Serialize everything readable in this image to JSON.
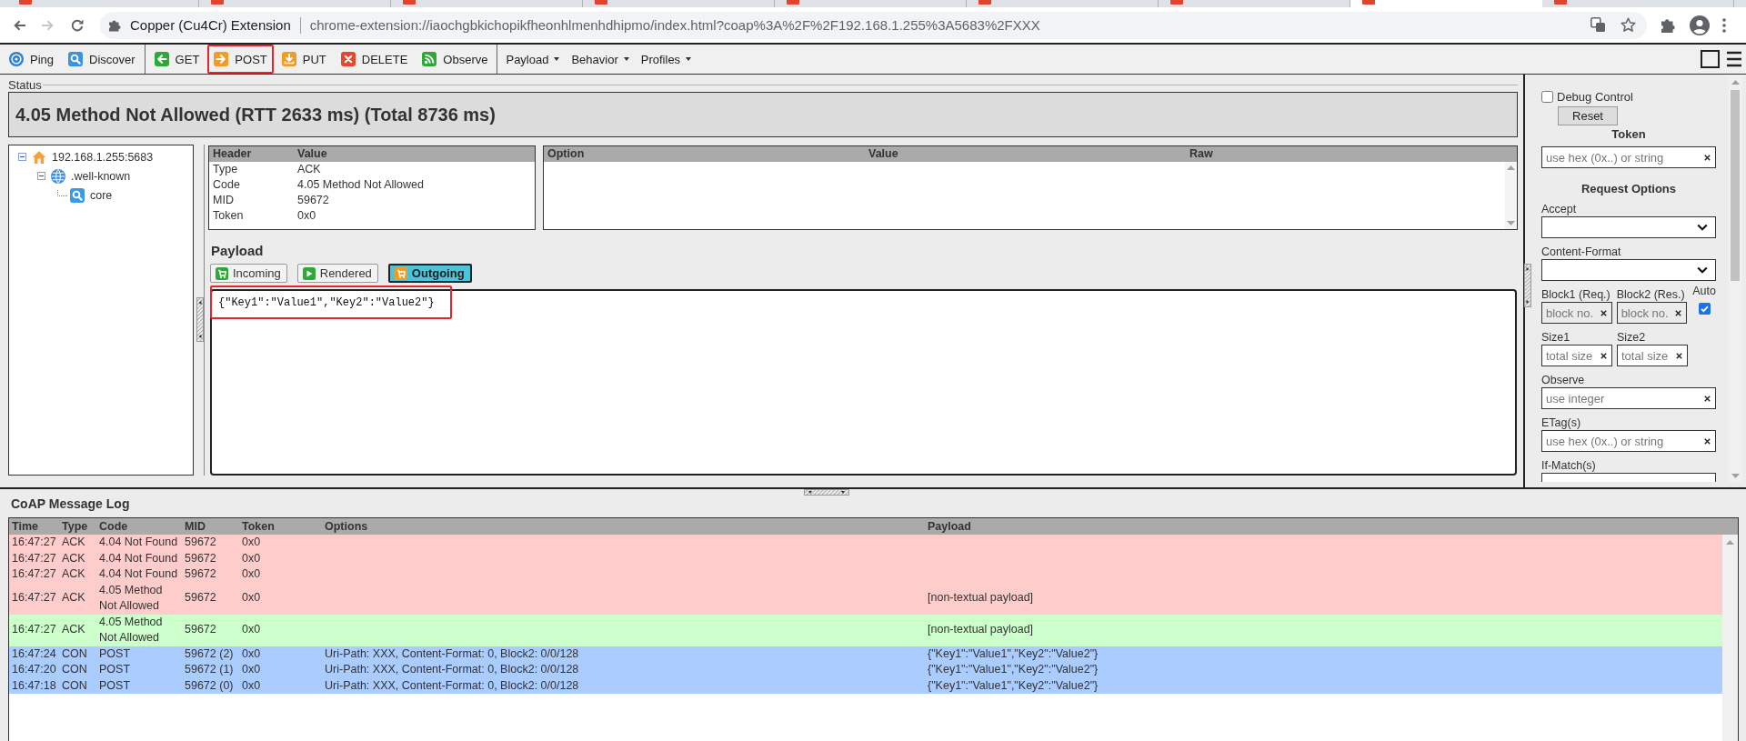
{
  "browser": {
    "tabs": [
      {
        "selected": false
      },
      {
        "selected": false
      },
      {
        "selected": false
      },
      {
        "selected": false
      },
      {
        "selected": false
      },
      {
        "selected": false
      },
      {
        "selected": false
      },
      {
        "selected": true
      },
      {
        "selected": false
      }
    ],
    "site_name": "Copper (Cu4Cr) Extension",
    "url": "chrome-extension://iaochgbkichopikfheonhlmenhdhipmo/index.html?coap%3A%2F%2F192.168.1.255%3A5683%2FXXX"
  },
  "toolbar": {
    "groups": [
      {
        "buttons": [
          {
            "kind": "ping",
            "label": "Ping",
            "highlighted": false
          },
          {
            "kind": "discover",
            "label": "Discover",
            "highlighted": false
          }
        ]
      },
      {
        "buttons": [
          {
            "kind": "get",
            "label": "GET",
            "highlighted": false
          },
          {
            "kind": "post",
            "label": "POST",
            "highlighted": true
          },
          {
            "kind": "put",
            "label": "PUT",
            "highlighted": false
          },
          {
            "kind": "delete",
            "label": "DELETE",
            "highlighted": false
          },
          {
            "kind": "observe",
            "label": "Observe",
            "highlighted": false
          }
        ]
      }
    ],
    "menus": [
      {
        "label": "Payload"
      },
      {
        "label": "Behavior"
      },
      {
        "label": "Profiles"
      }
    ]
  },
  "status": {
    "legend": "Status",
    "text": "4.05 Method Not Allowed (RTT 2633 ms) (Total 8736 ms)"
  },
  "tree": [
    {
      "kind": "host",
      "label": "192.168.1.255:5683",
      "expanded": true,
      "children": [
        {
          "kind": "folder",
          "label": ".well-known",
          "expanded": true,
          "children": [
            {
              "kind": "resource",
              "label": "core"
            }
          ]
        }
      ]
    }
  ],
  "header_table": {
    "columns": [
      "Header",
      "Value"
    ],
    "rows": [
      [
        "Type",
        "ACK"
      ],
      [
        "Code",
        "4.05 Method Not Allowed"
      ],
      [
        "MID",
        "59672"
      ],
      [
        "Token",
        "0x0"
      ]
    ]
  },
  "option_table": {
    "columns": [
      "Option",
      "Value",
      "Raw"
    ]
  },
  "payload": {
    "title": "Payload",
    "tabs": [
      {
        "kind": "incoming",
        "label": "Incoming",
        "selected": false
      },
      {
        "kind": "rendered",
        "label": "Rendered",
        "selected": false
      },
      {
        "kind": "outgoing",
        "label": "Outgoing",
        "selected": true
      }
    ],
    "value": "{\"Key1\":\"Value1\",\"Key2\":\"Value2\"}",
    "highlighted": true
  },
  "side_panel": {
    "debug": {
      "label": "Debug Control",
      "checked": false
    },
    "reset": "Reset",
    "token_title": "Token",
    "token": {
      "placeholder": "use hex (0x..) or string"
    },
    "options_title": "Request Options",
    "fields": [
      {
        "kind": "select",
        "label": "Accept"
      },
      {
        "kind": "select",
        "label": "Content-Format"
      },
      {
        "kind": "pair",
        "inputs": [
          {
            "label": "Block1 (Req.)",
            "placeholder": "block no.",
            "disabled": true
          },
          {
            "label": "Block2 (Res.)",
            "placeholder": "block no.",
            "disabled": true
          }
        ],
        "checkbox": {
          "label": "Auto",
          "checked": true
        }
      },
      {
        "kind": "pair",
        "inputs": [
          {
            "label": "Size1",
            "placeholder": "total size",
            "disabled": false
          },
          {
            "label": "Size2",
            "placeholder": "total size",
            "disabled": false
          }
        ]
      },
      {
        "kind": "text",
        "label": "Observe",
        "placeholder": "use integer"
      },
      {
        "kind": "text",
        "label": "ETag(s)",
        "placeholder": "use hex (0x..) or string"
      },
      {
        "kind": "text",
        "label": "If-Match(s)"
      }
    ]
  },
  "log": {
    "title": "CoAP Message Log",
    "columns": [
      "Time",
      "Type",
      "Code",
      "MID",
      "Token",
      "Options",
      "Payload"
    ],
    "rows": [
      {
        "color": "#ffcccc",
        "time": "16:47:27",
        "type": "ACK",
        "code": "4.04 Not Found",
        "mid": "59672",
        "token": "0x0"
      },
      {
        "color": "#ffcccc",
        "time": "16:47:27",
        "type": "ACK",
        "code": "4.04 Not Found",
        "mid": "59672",
        "token": "0x0"
      },
      {
        "color": "#ffcccc",
        "time": "16:47:27",
        "type": "ACK",
        "code": "4.04 Not Found",
        "mid": "59672",
        "token": "0x0"
      },
      {
        "color": "#ffcccc",
        "time": "16:47:27",
        "type": "ACK",
        "code": "4.05 Method Not Allowed",
        "mid": "59672",
        "token": "0x0",
        "payload": "[non-textual payload]"
      },
      {
        "color": "#ccffcc",
        "time": "16:47:27",
        "type": "ACK",
        "code": "4.05 Method Not Allowed",
        "mid": "59672",
        "token": "0x0",
        "payload": "[non-textual payload]"
      },
      {
        "color": "#aaccff",
        "time": "16:47:24",
        "type": "CON",
        "code": "POST",
        "mid": "59672 (2)",
        "token": "0x0",
        "options": "Uri-Path: XXX, Content-Format: 0, Block2: 0/0/128",
        "payload": "{\"Key1\":\"Value1\",\"Key2\":\"Value2\"}"
      },
      {
        "color": "#aaccff",
        "time": "16:47:20",
        "type": "CON",
        "code": "POST",
        "mid": "59672 (1)",
        "token": "0x0",
        "options": "Uri-Path: XXX, Content-Format: 0, Block2: 0/0/128",
        "payload": "{\"Key1\":\"Value1\",\"Key2\":\"Value2\"}"
      },
      {
        "color": "#aaccff",
        "time": "16:47:18",
        "type": "CON",
        "code": "POST",
        "mid": "59672 (0)",
        "token": "0x0",
        "options": "Uri-Path: XXX, Content-Format: 0, Block2: 0/0/128",
        "payload": "{\"Key1\":\"Value1\",\"Key2\":\"Value2\"}"
      }
    ]
  }
}
